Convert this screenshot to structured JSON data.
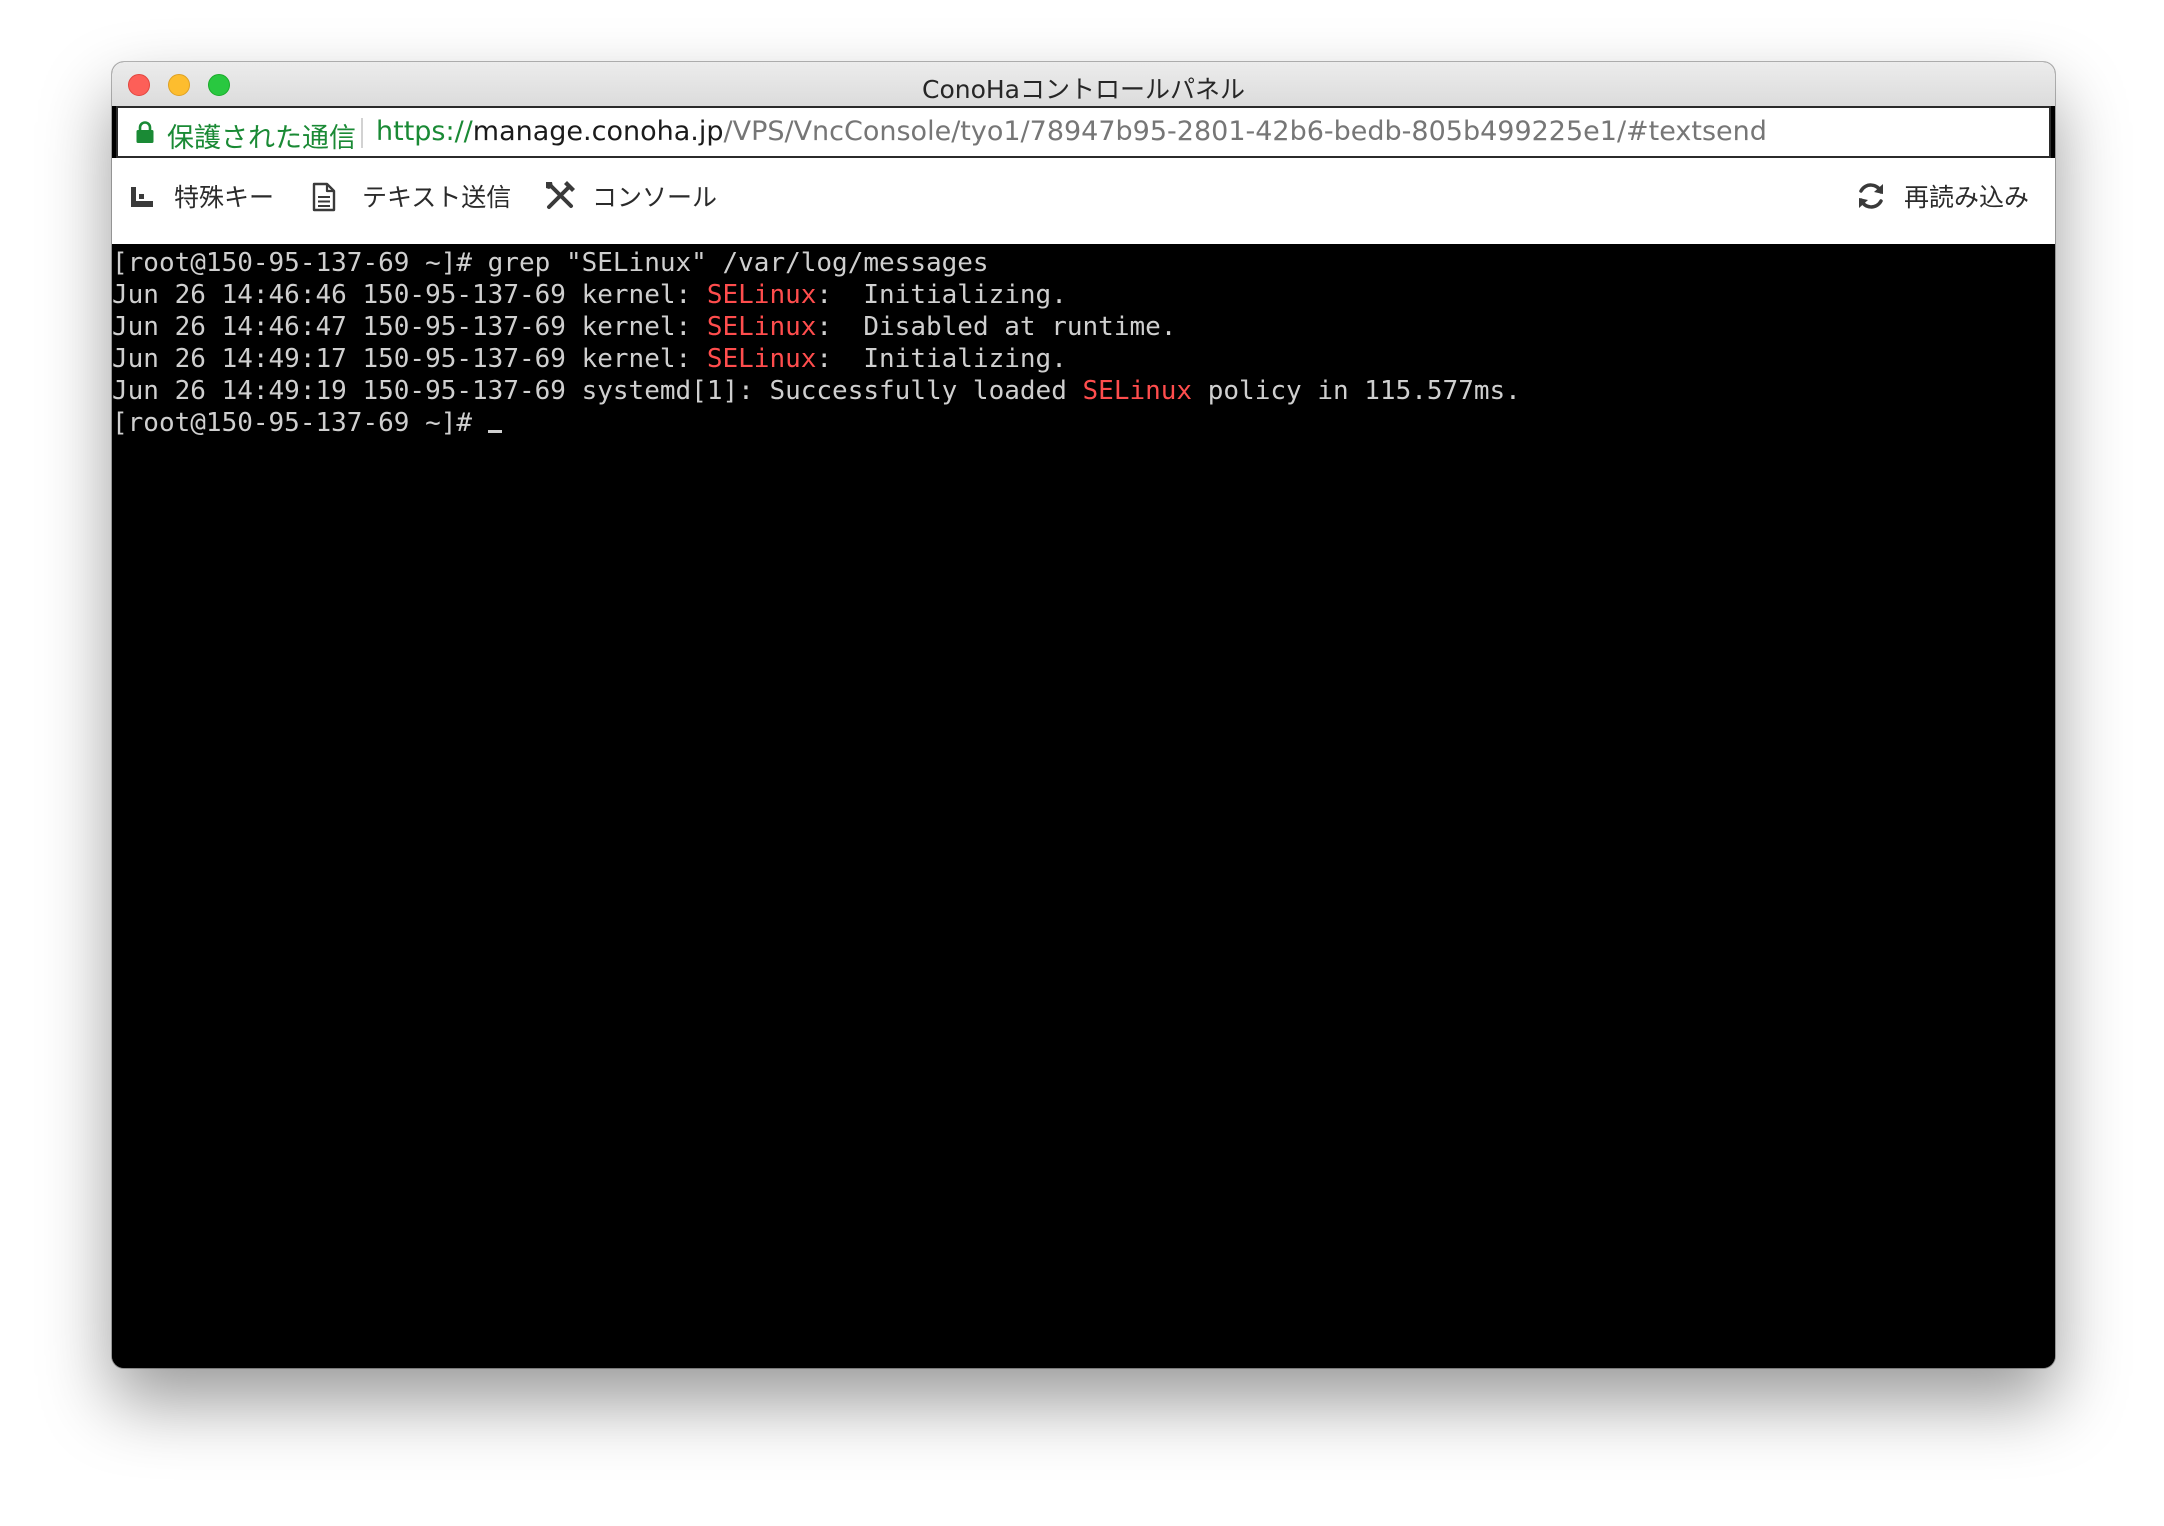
{
  "window": {
    "title": "ConoHaコントロールパネル"
  },
  "address_bar": {
    "secure_label": "保護された通信",
    "url_scheme": "https://",
    "url_host": "manage.conoha.jp",
    "url_path": "/VPS/VncConsole/tyo1/78947b95-2801-42b6-bedb-805b499225e1/#textsend",
    "secure_color": "#1a8a35"
  },
  "toolbar": {
    "special_keys": "特殊キー",
    "send_text": "テキスト送信",
    "console": "コンソール",
    "reload": "再読み込み"
  },
  "terminal": {
    "highlight_color": "#ff4d4d",
    "lines": [
      {
        "segments": [
          "[root@150-95-137-69 ~]# grep \"SELinux\" /var/log/messages"
        ]
      },
      {
        "segments": [
          "Jun 26 14:46:46 150-95-137-69 kernel: ",
          "SELinux",
          ":  Initializing."
        ]
      },
      {
        "segments": [
          "Jun 26 14:46:47 150-95-137-69 kernel: ",
          "SELinux",
          ":  Disabled at runtime."
        ]
      },
      {
        "segments": [
          "Jun 26 14:49:17 150-95-137-69 kernel: ",
          "SELinux",
          ":  Initializing."
        ]
      },
      {
        "segments": [
          "Jun 26 14:49:19 150-95-137-69 systemd[1]: Successfully loaded ",
          "SELinux",
          " policy in 115.577ms."
        ]
      },
      {
        "segments": [
          "[root@150-95-137-69 ~]# "
        ]
      }
    ]
  }
}
